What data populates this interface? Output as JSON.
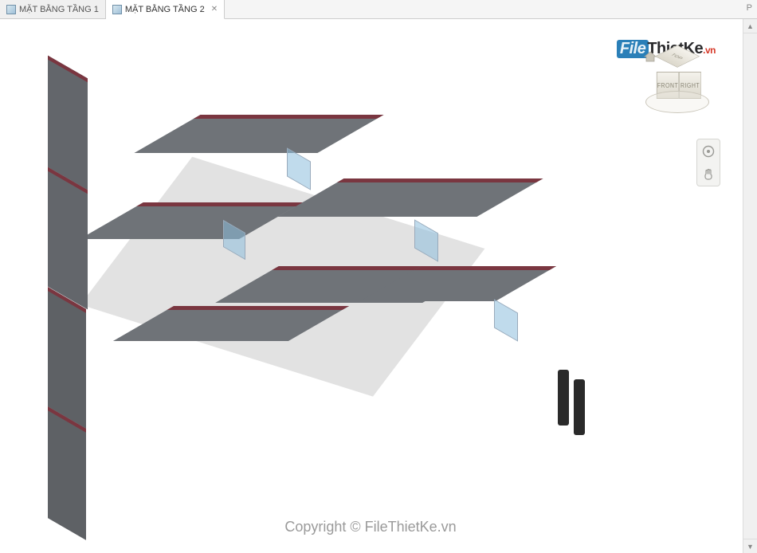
{
  "tabs": {
    "inactive": {
      "label": "MẶT BẰNG TẦNG 1"
    },
    "active": {
      "label": "MẶT BẰNG TẦNG 2"
    },
    "right_trunc": "P"
  },
  "viewcube": {
    "top": "TOP",
    "front": "FRONT",
    "right": "RIGHT"
  },
  "watermark": {
    "logo_file": "File",
    "logo_thietke": "ThietKe",
    "logo_vn": ".vn",
    "center": "Copyright © FileThietKe.vn"
  },
  "navbar": {
    "wheel": "steering-wheel",
    "pan": "pan-hand"
  }
}
